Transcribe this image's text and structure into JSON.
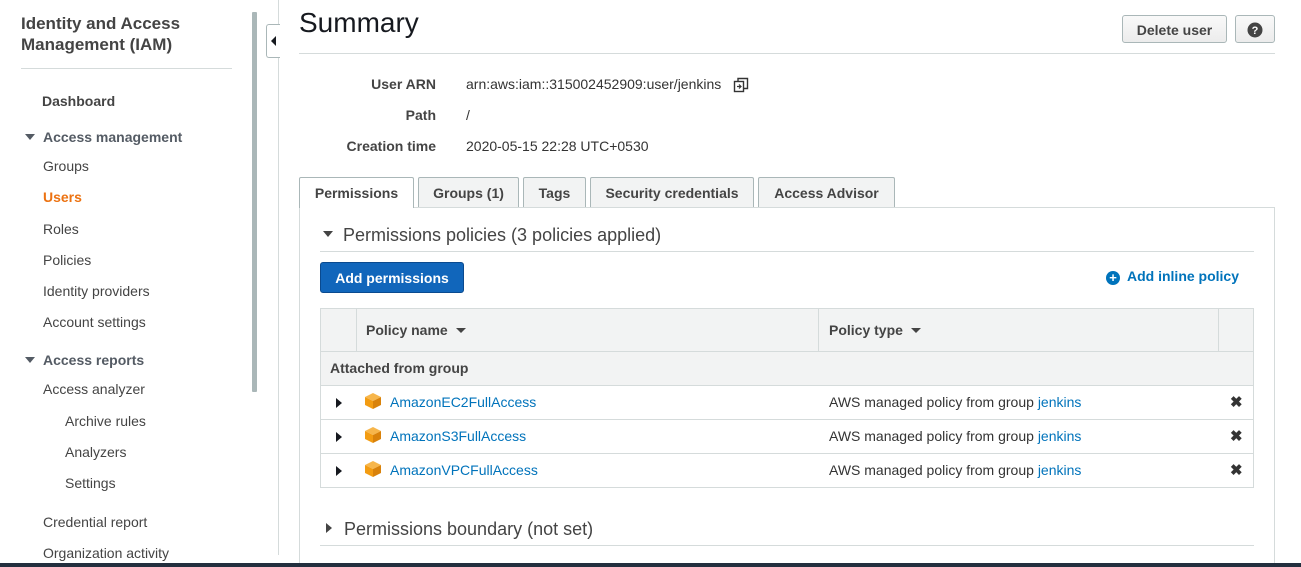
{
  "sidebar": {
    "title": "Identity and Access Management (IAM)",
    "dashboard": "Dashboard",
    "access_management": {
      "label": "Access management",
      "items": [
        "Groups",
        "Users",
        "Roles",
        "Policies",
        "Identity providers",
        "Account settings"
      ],
      "active": "Users"
    },
    "access_reports": {
      "label": "Access reports",
      "items": [
        "Access analyzer",
        "Archive rules",
        "Analyzers",
        "Settings",
        "Credential report",
        "Organization activity"
      ]
    }
  },
  "header": {
    "title": "Summary",
    "delete_user": "Delete user",
    "help_icon": "help-icon"
  },
  "summary": {
    "user_arn_label": "User ARN",
    "user_arn": "arn:aws:iam::315002452909:user/jenkins",
    "path_label": "Path",
    "path": "/",
    "creation_time_label": "Creation time",
    "creation_time": "2020-05-15 22:28 UTC+0530"
  },
  "tabs": [
    "Permissions",
    "Groups (1)",
    "Tags",
    "Security credentials",
    "Access Advisor"
  ],
  "active_tab": "Permissions",
  "permissions": {
    "section_title": "Permissions policies (3 policies applied)",
    "add_permissions": "Add permissions",
    "add_inline_policy": "Add inline policy",
    "table": {
      "col_policy_name": "Policy name",
      "col_policy_type": "Policy type",
      "group_label": "Attached from group",
      "rows": [
        {
          "name": "AmazonEC2FullAccess",
          "type_prefix": "AWS managed policy from group",
          "group": "jenkins"
        },
        {
          "name": "AmazonS3FullAccess",
          "type_prefix": "AWS managed policy from group",
          "group": "jenkins"
        },
        {
          "name": "AmazonVPCFullAccess",
          "type_prefix": "AWS managed policy from group",
          "group": "jenkins"
        }
      ]
    },
    "boundary_title": "Permissions boundary (not set)"
  },
  "colors": {
    "active_nav": "#ec7211",
    "link": "#0073bb",
    "primary_button": "#1166bb",
    "policy_icon": "#f39c12"
  }
}
